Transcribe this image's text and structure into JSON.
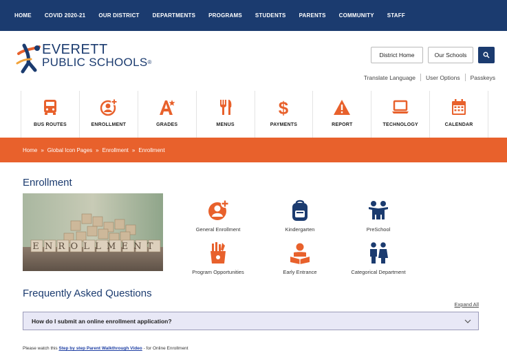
{
  "topnav": {
    "items": [
      "HOME",
      "COVID 2020-21",
      "OUR DISTRICT",
      "DEPARTMENTS",
      "PROGRAMS",
      "STUDENTS",
      "PARENTS",
      "COMMUNITY",
      "STAFF"
    ]
  },
  "header": {
    "logo_line1": "EVERETT",
    "logo_line2": "PUBLIC SCHOOLS",
    "logo_reg": "®",
    "district_home": "District Home",
    "our_schools": "Our Schools",
    "search_icon": "search-icon",
    "util_links": [
      "Translate Language",
      "User Options",
      "Passkeys"
    ]
  },
  "iconbar": {
    "items": [
      {
        "label": "BUS ROUTES",
        "icon": "bus-icon"
      },
      {
        "label": "ENROLLMENT",
        "icon": "enrollment-icon"
      },
      {
        "label": "GRADES",
        "icon": "grades-icon"
      },
      {
        "label": "MENUS",
        "icon": "utensils-icon"
      },
      {
        "label": "PAYMENTS",
        "icon": "dollar-icon"
      },
      {
        "label": "REPORT",
        "icon": "warning-icon"
      },
      {
        "label": "TECHNOLOGY",
        "icon": "laptop-icon"
      },
      {
        "label": "CALENDAR",
        "icon": "calendar-icon"
      }
    ],
    "icon_color": "#e8612c"
  },
  "breadcrumb": {
    "items": [
      "Home",
      "Global Icon Pages",
      "Enrollment",
      "Enrollment"
    ],
    "separator": "»"
  },
  "main": {
    "title": "Enrollment",
    "photo_text": "ENROLLMENT",
    "options": [
      {
        "label": "General Enrollment",
        "icon": "enrollment-icon",
        "color": "#e8612c"
      },
      {
        "label": "Kindergarten",
        "icon": "backpack-icon",
        "color": "#1b3b6f"
      },
      {
        "label": "PreSchool",
        "icon": "children-icon",
        "color": "#1b3b6f"
      },
      {
        "label": "Program Opportunities",
        "icon": "art-supplies-icon",
        "color": "#e8612c"
      },
      {
        "label": "Early Entrance",
        "icon": "reading-icon",
        "color": "#e8612c"
      },
      {
        "label": "Categorical Department",
        "icon": "family-icon",
        "color": "#1b3b6f"
      }
    ]
  },
  "faq": {
    "title": "Frequently Asked Questions",
    "expand_all": "Expand All",
    "question": "How do I submit an online enrollment application?",
    "note_prefix": "Please watch this",
    "note_link": "Step by step Parent Walkthrough Video",
    "note_suffix": "- for Online Enrollment"
  },
  "colors": {
    "navy": "#1b3b6f",
    "orange": "#e8612c"
  }
}
